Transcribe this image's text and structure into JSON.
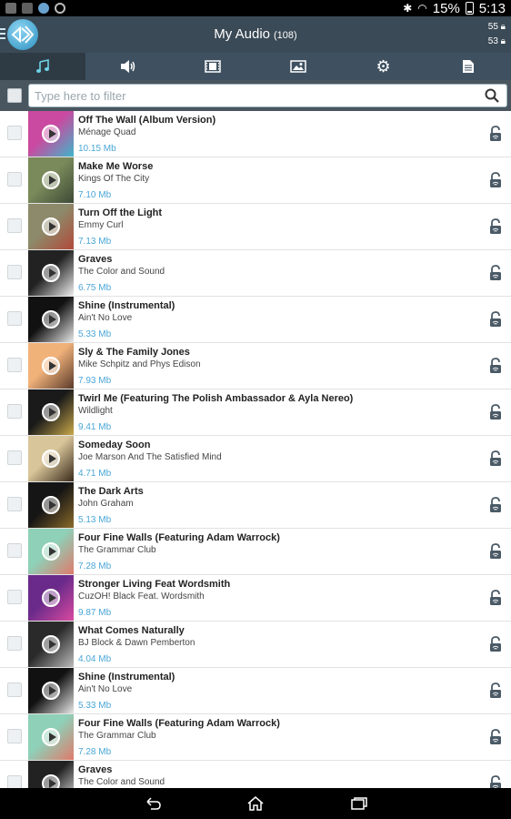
{
  "status_bar": {
    "battery": "15%",
    "time": "5:13"
  },
  "header": {
    "title": "My Audio",
    "count": "(108)",
    "count_top": "55",
    "count_bottom": "53"
  },
  "tabs": [
    {
      "icon": "music-note-icon",
      "active": true
    },
    {
      "icon": "speaker-icon",
      "active": false
    },
    {
      "icon": "film-icon",
      "active": false
    },
    {
      "icon": "image-icon",
      "active": false
    },
    {
      "icon": "gear-icon",
      "active": false
    },
    {
      "icon": "document-icon",
      "active": false
    }
  ],
  "filter": {
    "placeholder": "Type here to filter"
  },
  "tracks": [
    {
      "title": "Off The Wall (Album Version)",
      "artist": "Ménage Quad",
      "size": "10.15 Mb",
      "colors": [
        "#c94aa0",
        "#3fb6c9"
      ]
    },
    {
      "title": "Make Me Worse",
      "artist": "Kings Of The City",
      "size": "7.10 Mb",
      "colors": [
        "#7a8a5a",
        "#3d4a36"
      ]
    },
    {
      "title": "Turn Off the Light",
      "artist": "Emmy Curl",
      "size": "7.13 Mb",
      "colors": [
        "#8c8a6a",
        "#b24a3a"
      ]
    },
    {
      "title": "Graves",
      "artist": "The Color and Sound",
      "size": "6.75 Mb",
      "colors": [
        "#222222",
        "#eeeeee"
      ]
    },
    {
      "title": "Shine (Instrumental)",
      "artist": "Ain't No Love",
      "size": "5.33 Mb",
      "colors": [
        "#111111",
        "#e9e9e9"
      ]
    },
    {
      "title": "Sly & The Family Jones",
      "artist": "Mike Schpitz and Phys Edison",
      "size": "7.93 Mb",
      "colors": [
        "#f1b27a",
        "#5a3a2a"
      ]
    },
    {
      "title": "Twirl Me (Featuring The Polish Ambassador & Ayla Nereo)",
      "artist": "Wildlight",
      "size": "9.41 Mb",
      "colors": [
        "#1a1a1a",
        "#c9a94a"
      ]
    },
    {
      "title": "Someday Soon",
      "artist": "Joe Marson And The Satisfied Mind",
      "size": "4.71 Mb",
      "colors": [
        "#d8c59a",
        "#3a2a1a"
      ]
    },
    {
      "title": "The Dark Arts",
      "artist": "John Graham",
      "size": "5.13 Mb",
      "colors": [
        "#151515",
        "#8a6a2a"
      ]
    },
    {
      "title": "Four Fine Walls (Featuring Adam Warrock)",
      "artist": "The Grammar Club",
      "size": "7.28 Mb",
      "colors": [
        "#8ed0b8",
        "#e07a6a"
      ]
    },
    {
      "title": "Stronger Living Feat Wordsmith",
      "artist": "CuzOH! Black Feat. Wordsmith",
      "size": "9.87 Mb",
      "colors": [
        "#6a2a8a",
        "#d94aa0"
      ]
    },
    {
      "title": "What Comes Naturally",
      "artist": "BJ Block & Dawn Pemberton",
      "size": "4.04 Mb",
      "colors": [
        "#2a2a2a",
        "#bbbbbb"
      ]
    },
    {
      "title": "Shine (Instrumental)",
      "artist": "Ain't No Love",
      "size": "5.33 Mb",
      "colors": [
        "#111111",
        "#e9e9e9"
      ]
    },
    {
      "title": "Four Fine Walls (Featuring Adam Warrock)",
      "artist": "The Grammar Club",
      "size": "7.28 Mb",
      "colors": [
        "#8ed0b8",
        "#e07a6a"
      ]
    },
    {
      "title": "Graves",
      "artist": "The Color and Sound",
      "size": "",
      "colors": [
        "#222222",
        "#eeeeee"
      ]
    }
  ]
}
